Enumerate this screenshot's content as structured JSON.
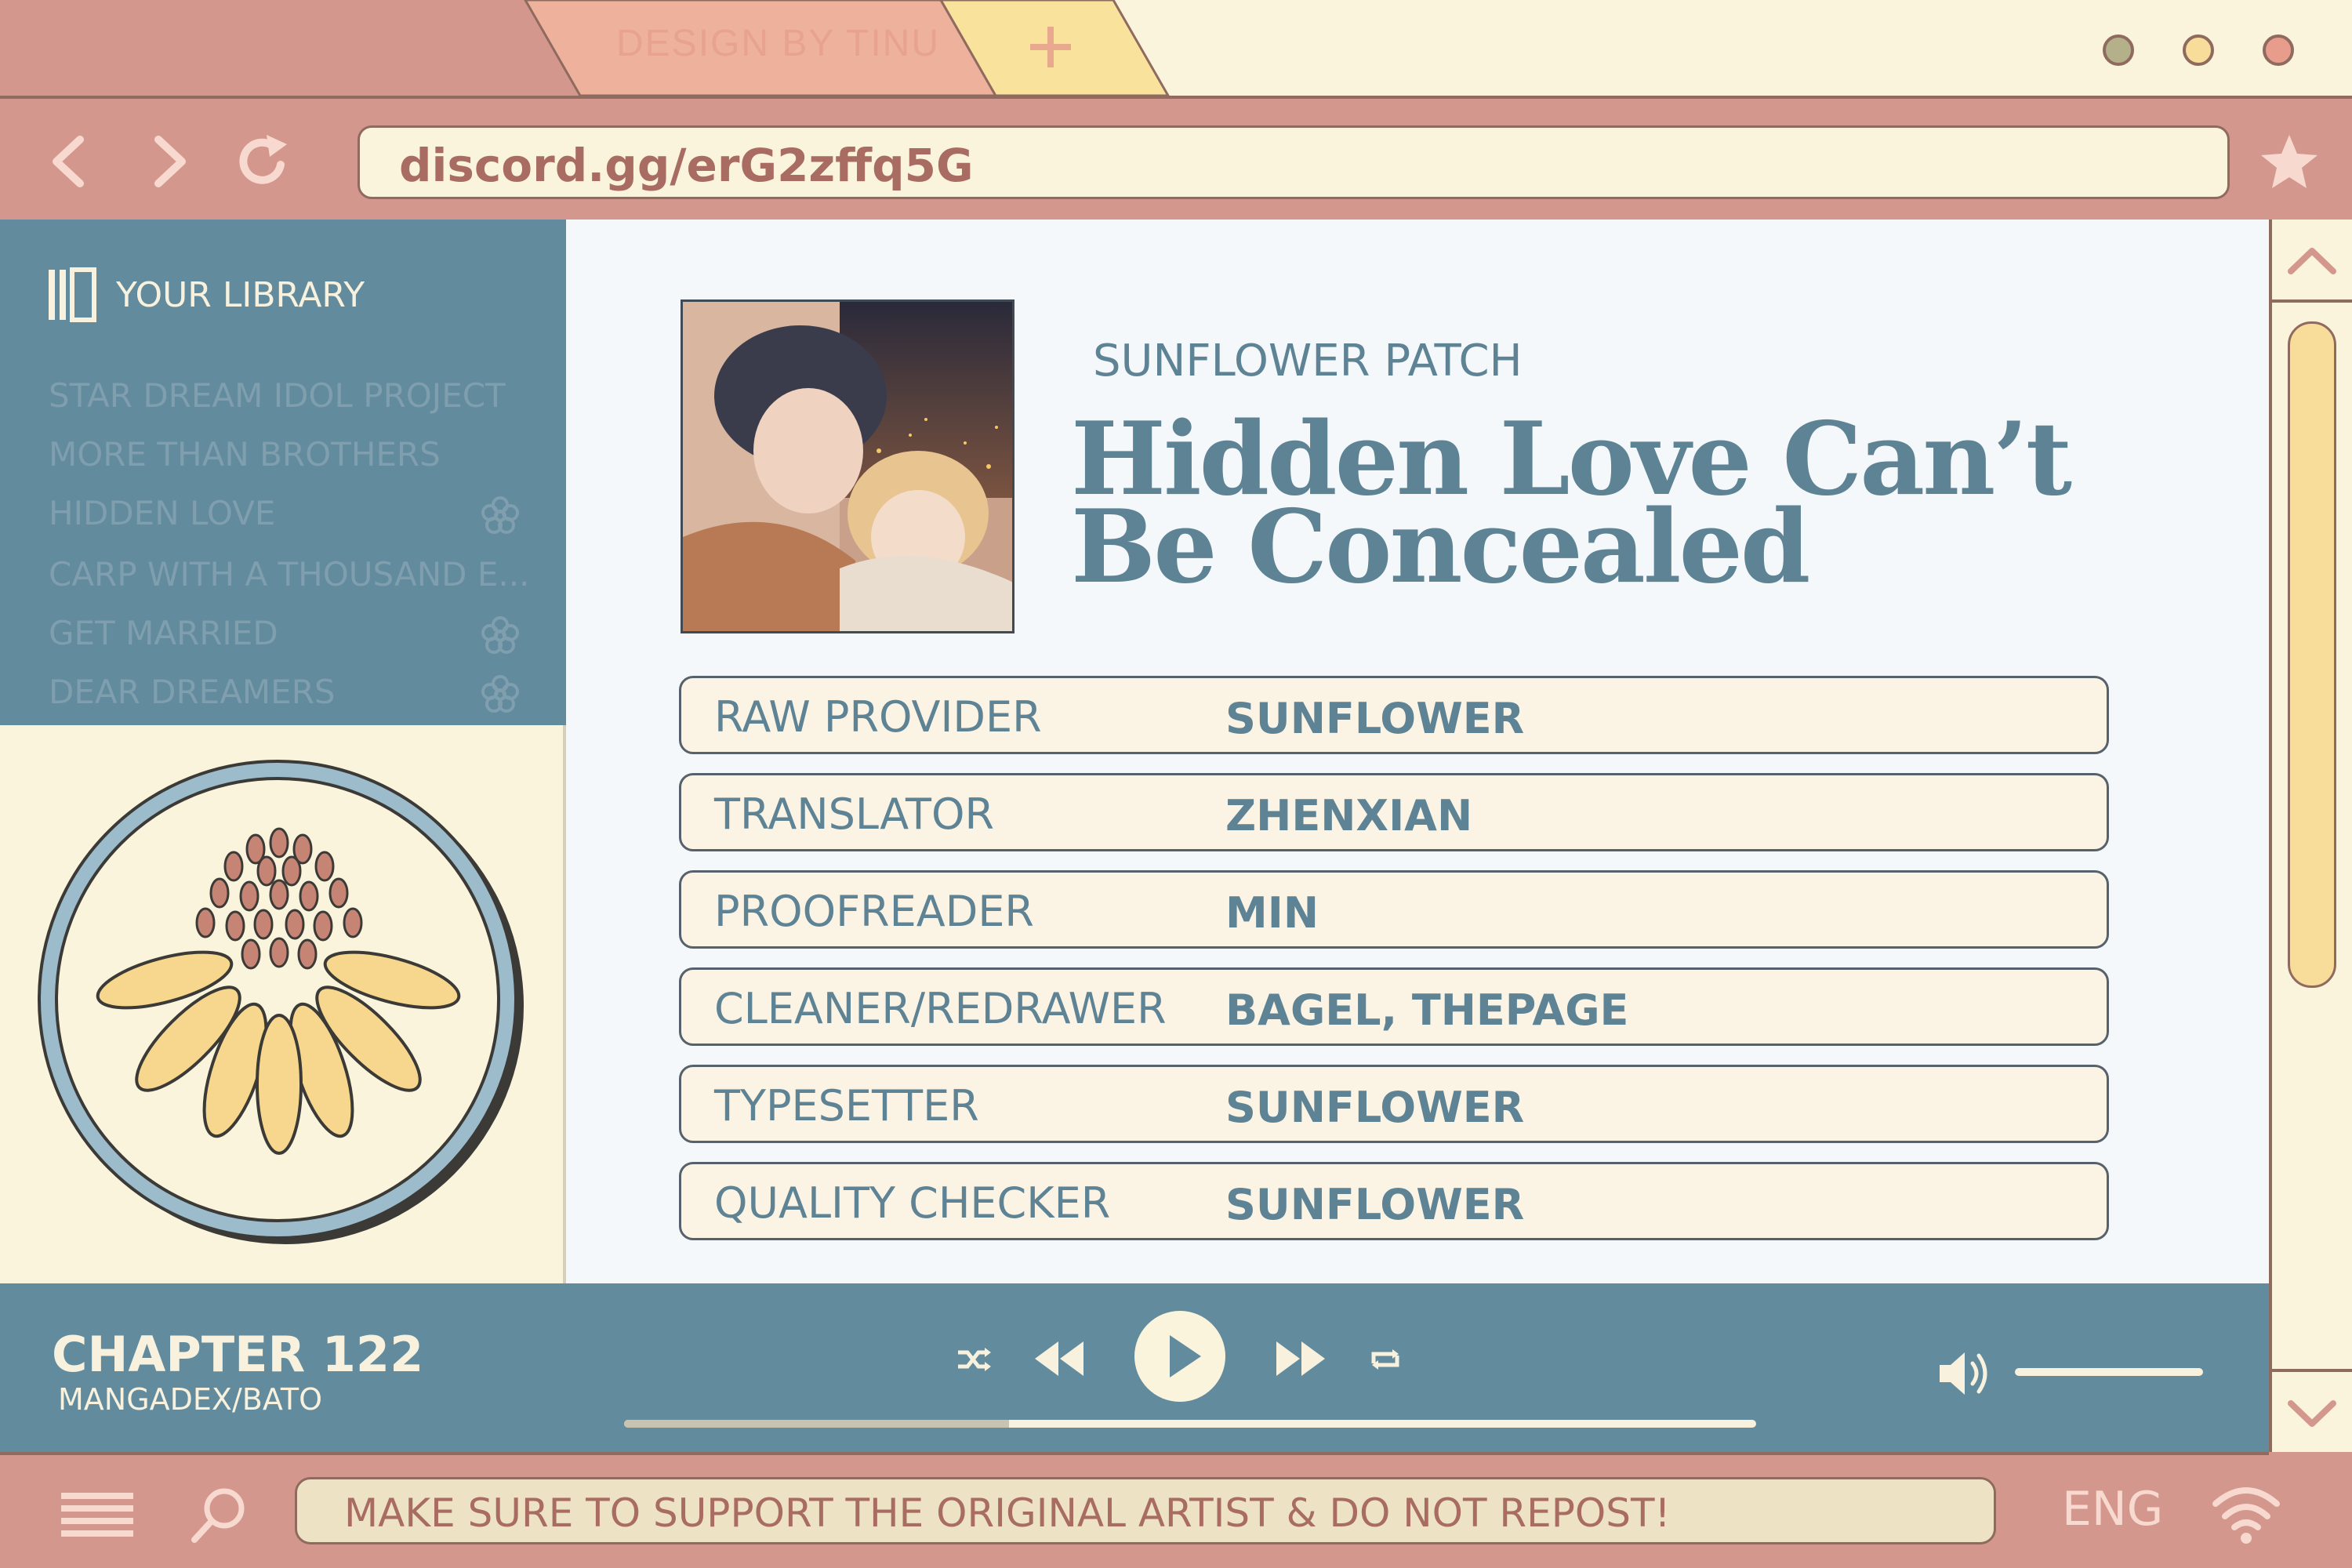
{
  "window": {
    "tab_label": "DESIGN BY TINU",
    "buttons": [
      "minimize",
      "maximize",
      "close"
    ]
  },
  "nav": {
    "address": "discord.gg/erG2zffq5G"
  },
  "sidebar": {
    "header": "YOUR LIBRARY",
    "items": [
      {
        "label": "STAR DREAM IDOL PROJECT",
        "flower": false
      },
      {
        "label": "MORE THAN BROTHERS",
        "flower": false
      },
      {
        "label": "HIDDEN LOVE",
        "flower": true
      },
      {
        "label": "CARP WITH A THOUSAND E...",
        "flower": false
      },
      {
        "label": "GET MARRIED",
        "flower": true
      },
      {
        "label": "DEAR DREAMERS",
        "flower": true
      }
    ]
  },
  "main": {
    "group": "SUNFLOWER PATCH",
    "title": "Hidden Love Can’t Be Concealed",
    "credits": [
      {
        "role": "RAW PROVIDER",
        "name": "SUNFLOWER"
      },
      {
        "role": "TRANSLATOR",
        "name": "ZHENXIAN"
      },
      {
        "role": "PROOFREADER",
        "name": "MIN"
      },
      {
        "role": "CLEANER/REDRAWER",
        "name": "BAGEL, THEPAGE"
      },
      {
        "role": "TYPESETTER",
        "name": "SUNFLOWER"
      },
      {
        "role": "QUALITY CHECKER",
        "name": "SUNFLOWER"
      }
    ]
  },
  "player": {
    "chapter": "CHAPTER 122",
    "source": "MANGADEX/BATO",
    "progress": 0.34,
    "volume": 1.0
  },
  "taskbar": {
    "notice": "MAKE SURE TO SUPPORT THE ORIGINAL ARTIST & DO NOT REPOST!",
    "language": "ENG"
  },
  "colors": {
    "rose": "#d4978d",
    "cream": "#faf4dc",
    "teal": "#628b9d",
    "yellow": "#f7dc9a",
    "peach": "#edb19c"
  }
}
